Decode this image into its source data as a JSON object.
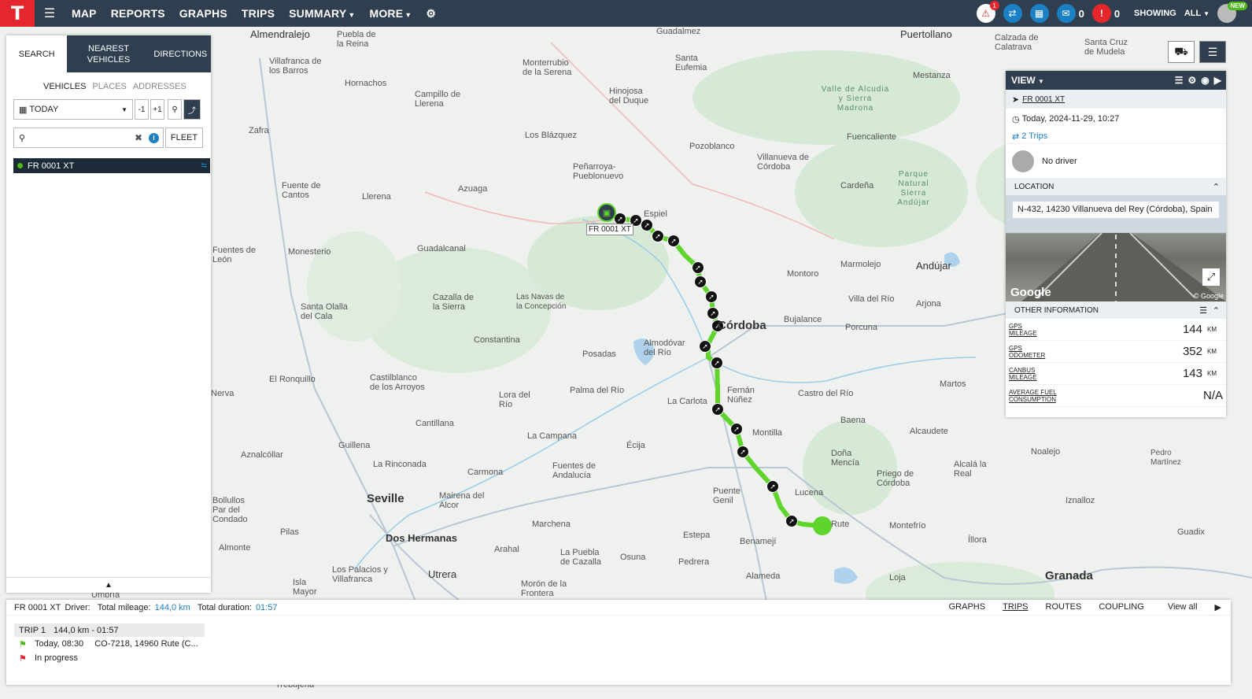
{
  "topbar": {
    "logo": "T",
    "nav": [
      "MAP",
      "REPORTS",
      "GRAPHS",
      "TRIPS",
      "SUMMARY",
      "MORE"
    ],
    "alerts_badge": "1",
    "messages_count": "0",
    "warnings_count": "0",
    "showing_label": "SHOWING",
    "showing_value": "ALL",
    "new_badge": "NEW"
  },
  "left_panel": {
    "tabs": [
      "SEARCH",
      "NEAREST VEHICLES",
      "DIRECTIONS"
    ],
    "subtabs": [
      "VEHICLES",
      "PLACES",
      "ADDRESSES"
    ],
    "date_value": "TODAY",
    "minus_btn": "-1",
    "plus_btn": "+1",
    "search_placeholder": "",
    "fleet_btn": "FLEET",
    "vehicle": "FR 0001 XT"
  },
  "right_panel": {
    "view_label": "VIEW",
    "vehicle": "FR 0001 XT",
    "datetime": "Today, 2024-11-29, 10:27",
    "trips": "2 Trips",
    "driver": "No driver",
    "location_title": "LOCATION",
    "address": "N-432, 14230 Villanueva del Rey (Córdoba), Spain",
    "google": "Google",
    "google_small": "© Google",
    "other_title": "OTHER INFORMATION",
    "info": [
      {
        "label1": "GPS",
        "label2": "MILEAGE",
        "value": "144",
        "unit": "KM"
      },
      {
        "label1": "GPS",
        "label2": "ODOMETER",
        "value": "352",
        "unit": "KM"
      },
      {
        "label1": "CANBUS",
        "label2": "MILEAGE",
        "value": "143",
        "unit": "KM"
      },
      {
        "label1": "AVERAGE FUEL",
        "label2": "CONSUMPTION",
        "value": "N/A",
        "unit": ""
      }
    ]
  },
  "map": {
    "vehicle_tag": "FR 0001 XT",
    "labels": {
      "l1": "Almendralejo",
      "l2": "Puebla de la Reina",
      "l3": "Villafranca de los Barros",
      "l4": "Hornachos",
      "l5": "Monterrubio de la Serena",
      "l6": "Campillo de Llerena",
      "l7": "Hinojosa del Duque",
      "l8": "Santa Eufemia",
      "l9": "Guadalmez",
      "l10": "Puertollano",
      "l11": "Calzada de Calatrava",
      "l12": "Santa Cruz de Mudela",
      "l13": "Mestanza",
      "l14": "Los Blázquez",
      "l15": "Pozoblanco",
      "l16": "Villanueva de Córdoba",
      "l17": "Fuencaliente",
      "l18": "Peñarroya-Pueblonuevo",
      "l19": "Fuente de Cantos",
      "l20": "Llerena",
      "l21": "Azuaga",
      "l22": "Espiel",
      "l23": "Cardeña",
      "l24": "Parque Natural Sierra Andújar",
      "l25": "Fuentes de León",
      "l26": "Monesterio",
      "l27": "Guadalcanal",
      "l28": "Montoro",
      "l29": "Marmolejo",
      "l30": "Andújar",
      "l31": "Santa Olalla del Cala",
      "l32": "Cazalla de la Sierra",
      "l33": "Las Navas de la Concepción",
      "l34": "Villa del Río",
      "l35": "Arjona",
      "l36": "Córdoba",
      "l37": "Bujalance",
      "l38": "Porcuna",
      "l39": "Constantina",
      "l40": "Almodóvar del Río",
      "l41": "Posadas",
      "l42": "El Ronquillo",
      "l43": "Castilblanco de los Arroyos",
      "l44": "Lora del Río",
      "l45": "Palma del Río",
      "l46": "Fernán Núñez",
      "l47": "La Carlota",
      "l48": "Castro del Río",
      "l49": "Martos",
      "l50": "Cantillana",
      "l51": "Baena",
      "l52": "Alcaudete",
      "l53": "Guillena",
      "l54": "La Campana",
      "l55": "Montilla",
      "l56": "Aznalcóllar",
      "l57": "La Rinconada",
      "l58": "Écija",
      "l59": "Doña Mencía",
      "l60": "Noalejo",
      "l61": "Pedro Martínez",
      "l62": "Carmona",
      "l63": "Fuentes de Andalucía",
      "l64": "Alcalá la Real",
      "l65": "Priego de Córdoba",
      "l66": "Seville",
      "l67": "Mairena del Alcor",
      "l68": "Puente Genil",
      "l69": "Lucena",
      "l70": "Iznalloz",
      "l71": "Bollullos Par del Condado",
      "l72": "Pilas",
      "l73": "Marchena",
      "l74": "Rute",
      "l75": "Montefrío",
      "l76": "Dos Hermanas",
      "l77": "Almonte",
      "l78": "Arahal",
      "l79": "Estepa",
      "l80": "Benamejí",
      "l81": "Íllora",
      "l82": "Guadix",
      "l83": "La Puebla de Cazalla",
      "l84": "Osuna",
      "l85": "Pedrera",
      "l86": "Los Palacios y Villafranca",
      "l87": "Utrera",
      "l88": "Alameda",
      "l89": "Loja",
      "l90": "Granada",
      "l91": "Isla Mayor",
      "l92": "Morón de la Frontera",
      "l93": "Valle de Alcudia y Sierra Madrona",
      "l94": "Nerva",
      "l95": "Zafra",
      "l96": "Trebujena",
      "l97": "Umbría"
    }
  },
  "bottom_panel": {
    "vehicle": "FR 0001 XT",
    "driver_label": "Driver:",
    "mileage_label": "Total mileage:",
    "mileage_value": "144,0 km",
    "duration_label": "Total duration:",
    "duration_value": "01:57",
    "tabs": [
      "GRAPHS",
      "TRIPS",
      "ROUTES",
      "COUPLING"
    ],
    "view_all": "View all",
    "trip_title": "TRIP 1",
    "trip_summary": "144,0 km - 01:57",
    "start_time": "Today, 08:30",
    "start_address": "CO-7218, 14960 Rute (C...",
    "status": "In progress"
  },
  "colors": {
    "topbar": "#2f3f4f",
    "brand_red": "#e6262d",
    "route_green": "#5fd42b",
    "link_blue": "#1b7fc4"
  }
}
